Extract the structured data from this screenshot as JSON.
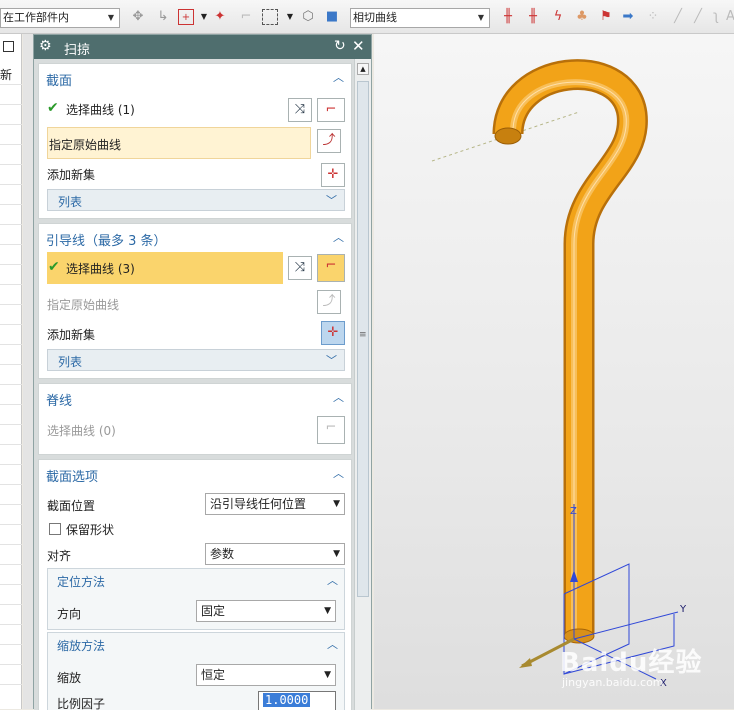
{
  "toolbar": {
    "filter_value": "在工作部件内",
    "curve_rule_value": "相切曲线",
    "icons": [
      "wcs-icon",
      "snap-icon",
      "select-icon",
      "dropdown-icon",
      "point-icon",
      "box-select-icon",
      "dropdown-icon",
      "view-icon",
      "cube-icon",
      "line-icon",
      "line2-icon",
      "curve-icon",
      "tree-icon",
      "flag-icon",
      "arrow-icon",
      "dots-icon",
      "slash-icon",
      "slash2-icon",
      "hook-icon",
      "a-icon"
    ]
  },
  "left_panel": {
    "header_text": "新"
  },
  "dialog": {
    "title": "扫掠",
    "section_profile": {
      "title": "截面",
      "select_curve_label": "选择曲线 (1)",
      "specify_origin_label": "指定原始曲线",
      "add_new_set_label": "添加新集",
      "list_label": "列表"
    },
    "section_guides": {
      "title": "引导线（最多 3 条）",
      "select_curve_label": "选择曲线 (3)",
      "specify_origin_label": "指定原始曲线",
      "add_new_set_label": "添加新集",
      "list_label": "列表"
    },
    "section_spine": {
      "title": "脊线",
      "select_curve_label": "选择曲线 (0)"
    },
    "section_options": {
      "title": "截面选项",
      "position_label": "截面位置",
      "position_value": "沿引导线任何位置",
      "preserve_shape_label": "保留形状",
      "align_label": "对齐",
      "align_value": "参数",
      "orientation": {
        "title": "定位方法",
        "direction_label": "方向",
        "direction_value": "固定"
      },
      "scaling": {
        "title": "缩放方法",
        "scale_label": "缩放",
        "scale_value": "恒定",
        "factor_label": "比例因子",
        "factor_value": "1.0000"
      }
    }
  },
  "viewport": {
    "axis_z": "Z",
    "axis_y": "Y",
    "axis_x": "X",
    "watermark_main": "Baidu经验",
    "watermark_sub": "jingyan.baidu.com"
  },
  "colors": {
    "title_bar": "#4f6e6e",
    "section_title": "#2d6aa6",
    "highlight_yellow": "#fad46c",
    "highlight_pale": "#fff3d3",
    "model_orange": "#f2a318",
    "check_green": "#2a9a2a"
  }
}
